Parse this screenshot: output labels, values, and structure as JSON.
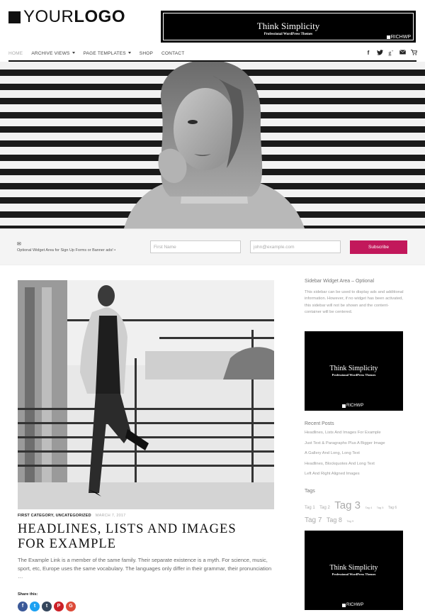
{
  "header": {
    "logo_light": "YOUR",
    "logo_bold": "LOGO",
    "banner": {
      "title": "Think Simplicity",
      "subtitle": "Professional WordPress Themes",
      "brand": "RICHWP"
    }
  },
  "nav": {
    "items": [
      {
        "label": "Home",
        "active": true,
        "caret": false
      },
      {
        "label": "Archive Views",
        "active": false,
        "caret": true
      },
      {
        "label": "Page Templates",
        "active": false,
        "caret": true
      },
      {
        "label": "Shop",
        "active": false,
        "caret": false
      },
      {
        "label": "Contact",
        "active": false,
        "caret": false
      }
    ],
    "icons": [
      "facebook-icon",
      "twitter-icon",
      "google-plus-icon",
      "email-icon",
      "cart-icon"
    ]
  },
  "signup": {
    "text": "Optional Widget Area for Sign Up Forms or Banner ads! •",
    "first_placeholder": "First Name",
    "email_placeholder": "john@example.com",
    "button_label": "Subscribe"
  },
  "post": {
    "categories": "FIRST CATEGORY, UNCATEGORIZED",
    "date": "MARCH 7, 2017",
    "title_line1": "HEADLINES, LISTS AND IMAGES",
    "title_line2": "FOR EXAMPLE",
    "excerpt": "The Example Link is a member of the same family. Their separate existence is a myth. For science, music, sport, etc, Europe uses the same vocabulary. The languages only differ in their grammar, their pronunciation …",
    "share_label": "Share this:"
  },
  "sidebar": {
    "widget_title": "Sidebar Widget Area – Optional",
    "widget_text": "This sidebar can be used to display ads and additional information. However, if no widget has been activated, this sidebar will not be shown and the content-container will be centered.",
    "ad": {
      "title": "Think Simplicity",
      "subtitle": "Professional WordPress Themes",
      "brand": "RICHWP"
    },
    "recent_title": "Recent Posts",
    "recent_posts": [
      "Headlines, Lists And Images For Example",
      "Just Text & Paragraphs Plus A Bigger Image",
      "A Gallery And Long, Long Text",
      "Headlines, Blockquotes And Long Text",
      "Left And Right Aligned Images"
    ],
    "tags_title": "Tags",
    "tags": [
      {
        "label": "Tag 1",
        "size": 6
      },
      {
        "label": "Tag 2",
        "size": 6
      },
      {
        "label": "Tag 3",
        "size": 15
      },
      {
        "label": "Tag 4",
        "size": 4
      },
      {
        "label": "Tag 5",
        "size": 4
      },
      {
        "label": "Tag 6",
        "size": 5
      },
      {
        "label": "Tag 7",
        "size": 10
      },
      {
        "label": "Tag 8",
        "size": 9
      },
      {
        "label": "Tag 9",
        "size": 4
      }
    ]
  }
}
